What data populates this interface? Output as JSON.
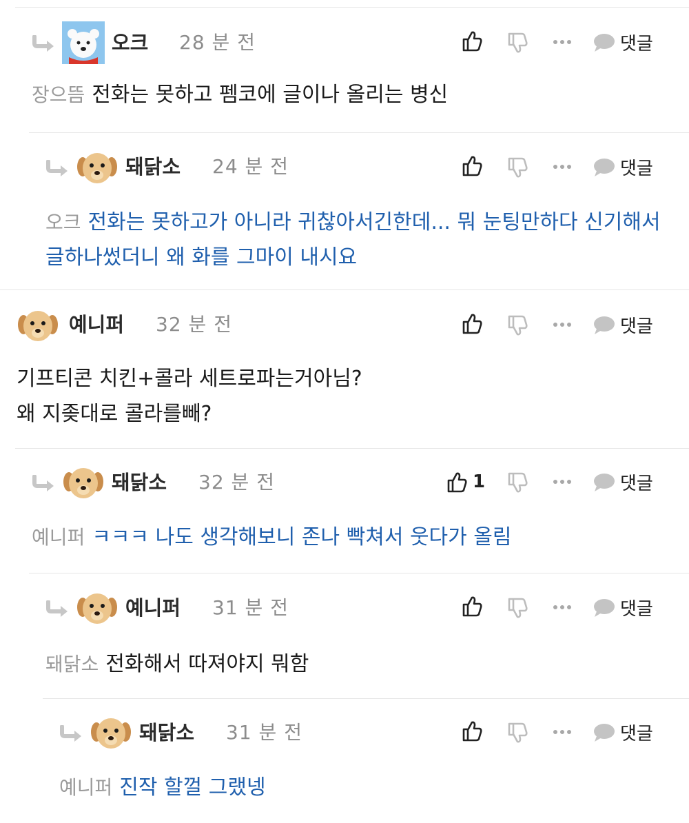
{
  "comments": [
    {
      "author": "오크",
      "time": "28 분 전",
      "mention": "장으뜸",
      "text": "전화는 못하고 펨코에 글이나 올리는 병신",
      "likes": "",
      "reply_label": "댓글",
      "text_color": "#1a1a1a",
      "avatar": "polar-bear"
    },
    {
      "author": "돼닭소",
      "time": "24 분 전",
      "mention": "오크",
      "text": "전화는 못하고가 아니라 귀찮아서긴한데... 뭐 눈팅만하다 신기해서 글하나썼더니 왜 화를 그마이 내시요",
      "likes": "",
      "reply_label": "댓글",
      "text_color": "#1f5fad",
      "avatar": "puppy"
    },
    {
      "author": "예니퍼",
      "time": "32 분 전",
      "mention": "",
      "text": "기프티콘 치킨+콜라 세트로파는거아님?\n왜 지좆대로 콜라를빼?",
      "likes": "",
      "reply_label": "댓글",
      "text_color": "#1a1a1a",
      "avatar": "puppy"
    },
    {
      "author": "돼닭소",
      "time": "32 분 전",
      "mention": "예니퍼",
      "text": "ㅋㅋㅋ 나도 생각해보니 존나 빡쳐서 웃다가 올림",
      "likes": "1",
      "reply_label": "댓글",
      "text_color": "#1f5fad",
      "avatar": "puppy"
    },
    {
      "author": "예니퍼",
      "time": "31 분 전",
      "mention": "돼닭소",
      "text": "전화해서 따져야지 뭐함",
      "likes": "",
      "reply_label": "댓글",
      "text_color": "#1a1a1a",
      "avatar": "puppy"
    },
    {
      "author": "돼닭소",
      "time": "31 분 전",
      "mention": "예니퍼",
      "text": "진작 할껄 그랬넹",
      "likes": "",
      "reply_label": "댓글",
      "text_color": "#1f5fad",
      "avatar": "puppy"
    }
  ]
}
